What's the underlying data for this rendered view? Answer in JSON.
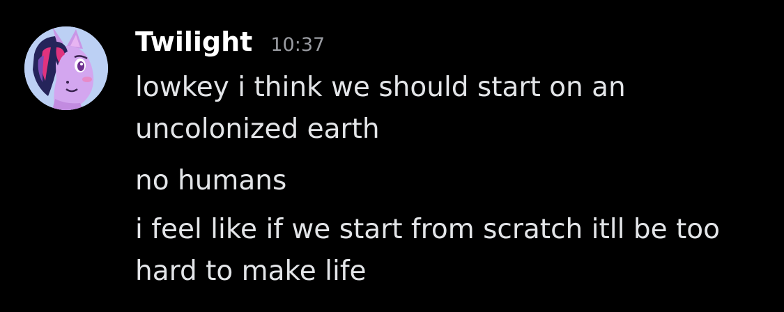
{
  "message_group": {
    "author": "Twilight",
    "timestamp": "10:37",
    "avatar_icon": "twilight-sparkle-pony-avatar-icon",
    "avatar_bg": "#bcd0f4",
    "messages": [
      {
        "lines": [
          "lowkey i think we should start on an",
          "uncolonized earth"
        ]
      },
      {
        "lines": [
          "no humans"
        ]
      },
      {
        "lines": [
          "i feel like if we start from scratch itll be too",
          "hard to make life"
        ]
      }
    ]
  },
  "colors": {
    "background": "#000000",
    "username": "#ffffff",
    "timestamp": "#9a9ca2",
    "message_text": "#e3e5e8"
  }
}
